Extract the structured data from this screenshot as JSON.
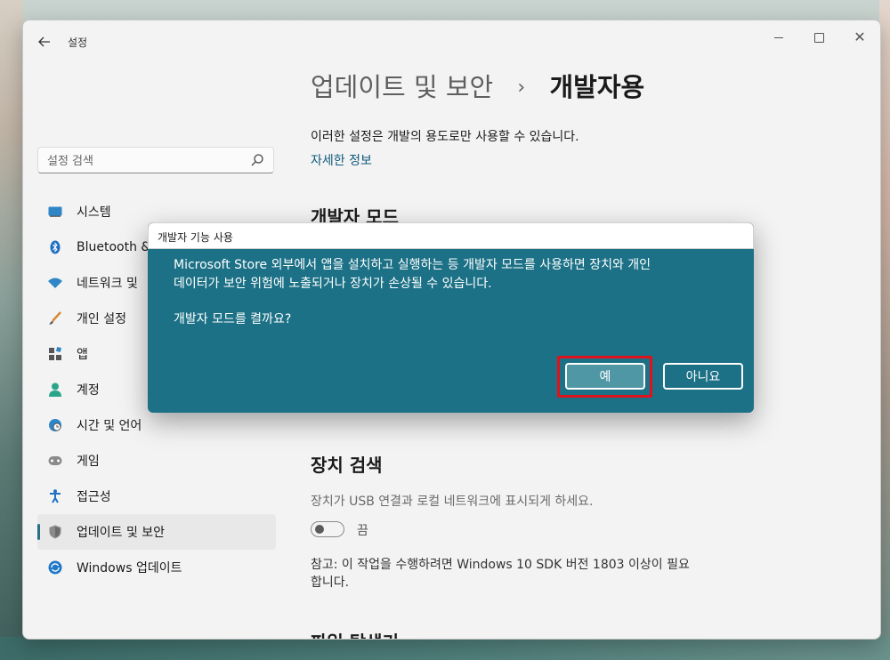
{
  "window": {
    "title": "설정"
  },
  "sidebar": {
    "search_placeholder": "설정 검색",
    "items": [
      {
        "label": "시스템",
        "icon": "monitor-icon"
      },
      {
        "label": "Bluetooth &",
        "icon": "bluetooth-icon"
      },
      {
        "label": "네트워크 및",
        "icon": "wifi-icon"
      },
      {
        "label": "개인 설정",
        "icon": "brush-icon"
      },
      {
        "label": "앱",
        "icon": "apps-icon"
      },
      {
        "label": "계정",
        "icon": "person-icon"
      },
      {
        "label": "시간 및 언어",
        "icon": "clock-globe-icon"
      },
      {
        "label": "게임",
        "icon": "gamepad-icon"
      },
      {
        "label": "접근성",
        "icon": "accessibility-icon"
      },
      {
        "label": "업데이트 및 보안",
        "icon": "shield-icon",
        "active": true
      },
      {
        "label": "Windows 업데이트",
        "icon": "sync-icon"
      }
    ]
  },
  "main": {
    "breadcrumb_parent": "업데이트 및 보안",
    "breadcrumb_sep": "›",
    "breadcrumb_current": "개발자용",
    "description": "이러한 설정은 개발의 용도로만 사용할 수 있습니다.",
    "learn_more": "자세한 정보",
    "dev_mode_heading": "개발자 모드",
    "device_discovery_heading": "장치 검색",
    "device_discovery_desc": "장치가 USB 연결과 로컬 네트워크에 표시되게 하세요.",
    "toggle_state": "끔",
    "note_line1": "참고: 이 작업을 수행하려면 Windows 10 SDK 버전 1803 이상이 필요",
    "note_line2": "합니다.",
    "next_heading": "파일 탐색기"
  },
  "dialog": {
    "title": "개발자 기능 사용",
    "message_line1": "Microsoft Store 외부에서 앱을 설치하고 실행하는 등 개발자 모드를 사용하면 장치와 개인",
    "message_line2": "데이터가 보안 위험에 노출되거나 장치가 손상될 수 있습니다.",
    "question": "개발자 모드를 켤까요?",
    "yes_label": "예",
    "no_label": "아니요"
  },
  "colors": {
    "dialog_bg": "#1c7186",
    "accent": "#2a6f85",
    "highlight": "#e0121d"
  }
}
